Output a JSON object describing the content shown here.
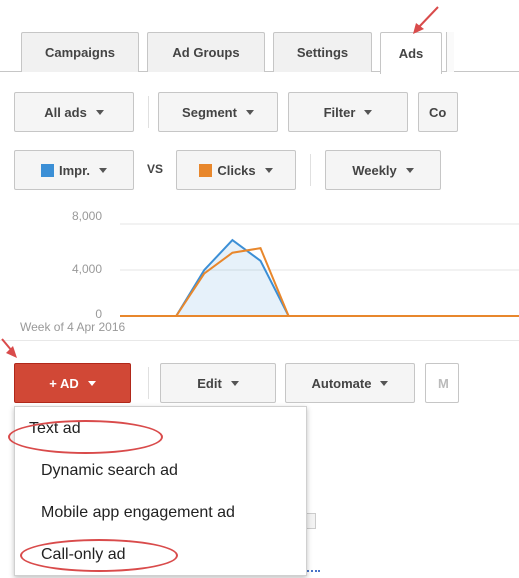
{
  "tabs": [
    {
      "label": "Campaigns"
    },
    {
      "label": "Ad Groups"
    },
    {
      "label": "Settings"
    },
    {
      "label": "Ads"
    }
  ],
  "toolbar": {
    "all_ads": "All ads",
    "segment": "Segment",
    "filter": "Filter",
    "columns_partial": "Co"
  },
  "metrics": {
    "metric1": "Impr.",
    "metric1_color": "#3b8fd6",
    "vs": "VS",
    "metric2": "Clicks",
    "metric2_color": "#e8872c",
    "period": "Weekly"
  },
  "chart_data": {
    "type": "line",
    "x_axis_note": "Week of 4 Apr 2016",
    "y_ticks": [
      "8,000",
      "4,000",
      "0"
    ],
    "ylim": [
      0,
      8000
    ],
    "series": [
      {
        "values": [
          0,
          0,
          0,
          4000,
          6600,
          4800,
          0,
          0,
          0,
          0,
          0,
          0,
          0,
          0,
          0
        ],
        "color": "#3b8fd6"
      },
      {
        "values": [
          0,
          0,
          0,
          3700,
          5500,
          5900,
          0,
          0,
          0,
          0,
          0,
          0,
          0,
          0,
          0
        ],
        "color": "#e8872c"
      }
    ]
  },
  "actions": {
    "add": "+ AD",
    "edit": "Edit",
    "automate": "Automate",
    "more_partial": "M"
  },
  "menu": {
    "items": [
      {
        "label": "Text ad"
      },
      {
        "label": "Dynamic search ad"
      },
      {
        "label": "Mobile app engagement ad"
      },
      {
        "label": "Call-only ad"
      }
    ]
  },
  "colors": {
    "add_button": "#d14836",
    "annotation": "#d94b4b"
  }
}
